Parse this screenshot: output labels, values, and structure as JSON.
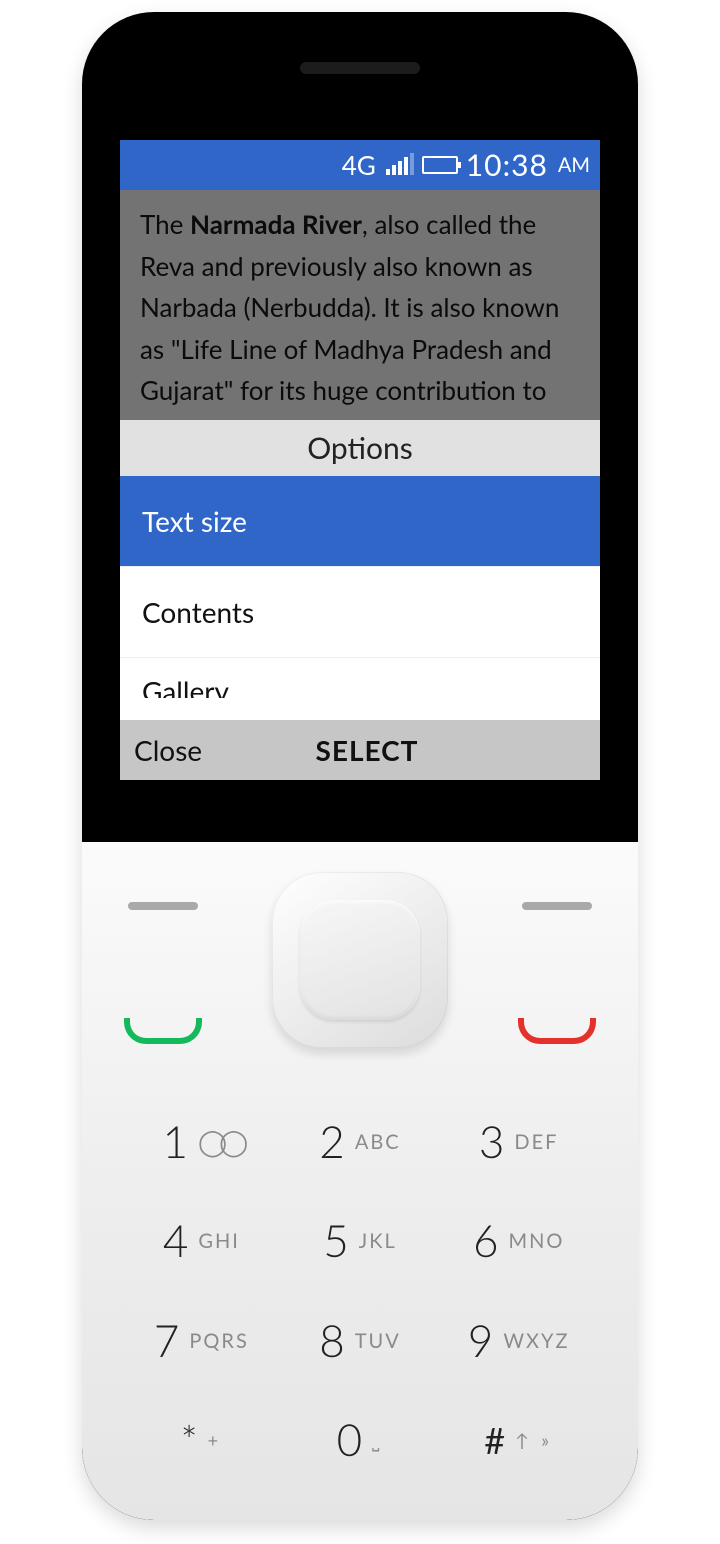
{
  "status": {
    "network": "4G",
    "time": "10:38",
    "ampm": "AM"
  },
  "article": {
    "prefix": "The ",
    "bold": "Narmada River",
    "rest": ", also called the Reva and previously also known as Narbada (Nerbudda). It is also known as \"Life Line of Madhya Pradesh and Gujarat\" for its huge contribution to the"
  },
  "options": {
    "title": "Options",
    "items": [
      "Text size",
      "Contents",
      "Gallery"
    ]
  },
  "softkeys": {
    "left": "Close",
    "center": "SELECT"
  },
  "keypad": [
    {
      "digit": "1",
      "letters": ""
    },
    {
      "digit": "2",
      "letters": "ABC"
    },
    {
      "digit": "3",
      "letters": "DEF"
    },
    {
      "digit": "4",
      "letters": "GHI"
    },
    {
      "digit": "5",
      "letters": "JKL"
    },
    {
      "digit": "6",
      "letters": "MNO"
    },
    {
      "digit": "7",
      "letters": "PQRS"
    },
    {
      "digit": "8",
      "letters": "TUV"
    },
    {
      "digit": "9",
      "letters": "WXYZ"
    },
    {
      "digit": "*",
      "letters": "+"
    },
    {
      "digit": "0",
      "letters": "⎵"
    },
    {
      "digit": "#",
      "letters": "↑ »"
    }
  ]
}
